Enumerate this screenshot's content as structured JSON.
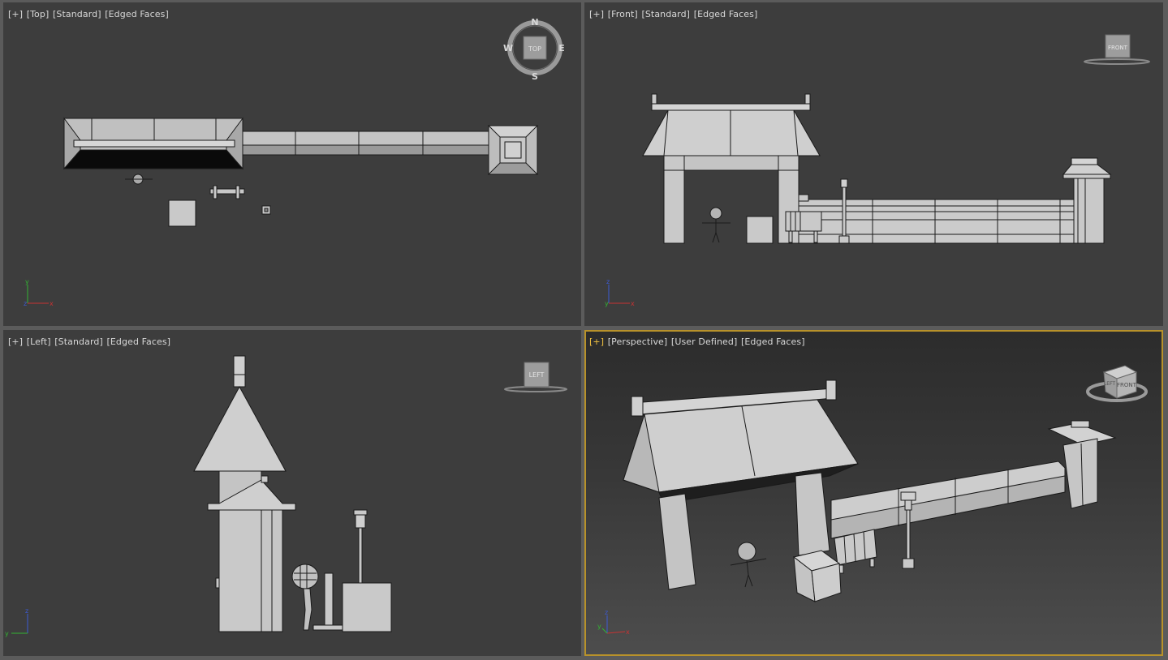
{
  "viewports": {
    "top": {
      "menu": "[+]",
      "view": "[Top]",
      "shading": "[Standard]",
      "display": "[Edged Faces]",
      "gizmo_label": "TOP",
      "compass": {
        "n": "N",
        "s": "S",
        "e": "E",
        "w": "W"
      },
      "axes": {
        "x": "x",
        "y": "y",
        "z": "z"
      }
    },
    "front": {
      "menu": "[+]",
      "view": "[Front]",
      "shading": "[Standard]",
      "display": "[Edged Faces]",
      "gizmo_label": "FRONT",
      "axes": {
        "x": "x",
        "y": "y",
        "z": "z"
      }
    },
    "left": {
      "menu": "[+]",
      "view": "[Left]",
      "shading": "[Standard]",
      "display": "[Edged Faces]",
      "gizmo_label": "LEFT",
      "axes": {
        "x": "x",
        "y": "y",
        "z": "z"
      }
    },
    "perspective": {
      "menu": "[+]",
      "view": "[Perspective]",
      "shading": "[User Defined]",
      "display": "[Edged Faces]",
      "gizmo_label": "FRONT",
      "gizmo_side": "LEFT",
      "axes": {
        "x": "x",
        "y": "y",
        "z": "z"
      },
      "active": true
    }
  },
  "colors": {
    "viewport_bg": "#3d3d3d",
    "separator": "#5b5b5b",
    "active_border": "#b8922a",
    "label_text": "#d8d8d8",
    "active_plus": "#f0c040",
    "geometry_fill": "#c9c9c9",
    "edges": "#1a1a1a",
    "axis_x": "#c83232",
    "axis_y": "#32b432",
    "axis_z": "#3c5ad2"
  }
}
